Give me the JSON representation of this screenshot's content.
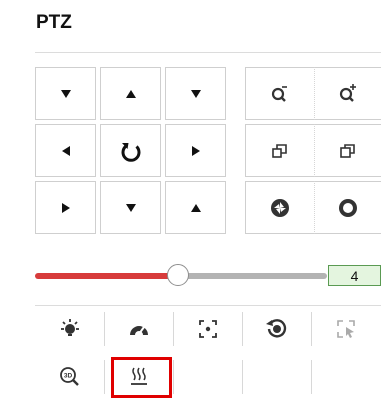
{
  "panel": {
    "title": "PTZ"
  },
  "direction_pad": {
    "buttons": [
      {
        "name": "pan-up-left-button",
        "icon": "arrow-up-left-icon"
      },
      {
        "name": "tilt-up-button",
        "icon": "arrow-up-icon"
      },
      {
        "name": "pan-up-right-button",
        "icon": "arrow-up-right-icon"
      },
      {
        "name": "pan-left-button",
        "icon": "arrow-left-icon"
      },
      {
        "name": "auto-pan-button",
        "icon": "rotate-icon"
      },
      {
        "name": "pan-right-button",
        "icon": "arrow-right-icon"
      },
      {
        "name": "pan-down-left-button",
        "icon": "arrow-down-left-icon"
      },
      {
        "name": "tilt-down-button",
        "icon": "arrow-down-icon"
      },
      {
        "name": "pan-down-right-button",
        "icon": "arrow-down-right-icon"
      }
    ]
  },
  "lens_controls": [
    {
      "name": "zoom-out-button",
      "icon": "zoom-out-icon"
    },
    {
      "name": "zoom-in-button",
      "icon": "zoom-in-icon"
    },
    {
      "name": "focus-near-button",
      "icon": "focus-near-icon"
    },
    {
      "name": "focus-far-button",
      "icon": "focus-far-icon"
    },
    {
      "name": "iris-close-button",
      "icon": "iris-close-icon"
    },
    {
      "name": "iris-open-button",
      "icon": "iris-open-icon"
    }
  ],
  "speed": {
    "value": "4",
    "level_fraction": 0.5,
    "track_color": "#d73b3b"
  },
  "toolbar_row1": [
    {
      "name": "light-button",
      "icon": "light-bulb-icon"
    },
    {
      "name": "wiper-button",
      "icon": "wiper-icon"
    },
    {
      "name": "one-touch-focus-button",
      "icon": "focus-frame-icon"
    },
    {
      "name": "lens-init-button",
      "icon": "lens-initialize-icon"
    },
    {
      "name": "manual-tracking-button",
      "icon": "manual-tracking-icon"
    }
  ],
  "toolbar_row2": [
    {
      "name": "3d-zoom-button",
      "icon": "3d-zoom-icon"
    },
    {
      "name": "heater-button",
      "icon": "heater-icon"
    }
  ],
  "colors": {
    "highlight": "#e00000",
    "speed_box_bg": "#e4f5df",
    "speed_box_border": "#5a9a52"
  }
}
